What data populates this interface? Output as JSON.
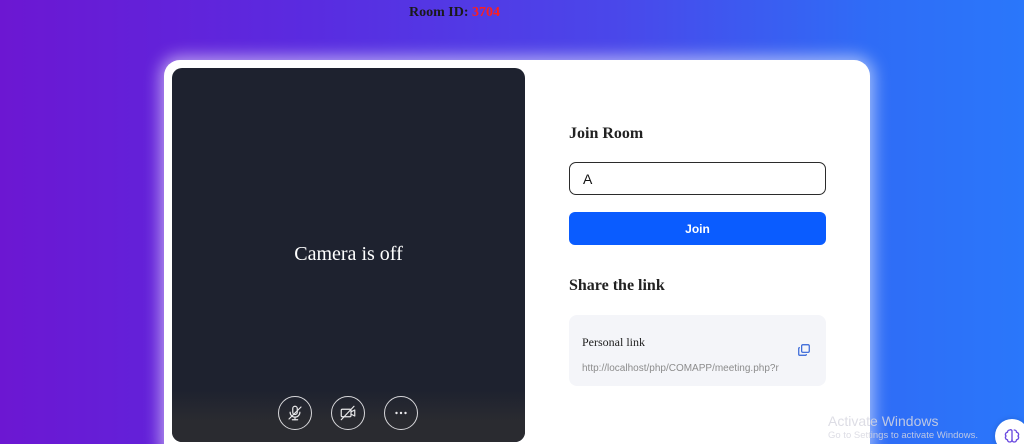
{
  "header": {
    "room_label": "Room ID:",
    "room_number": "3704"
  },
  "video": {
    "camera_status": "Camera is off",
    "controls": [
      {
        "name": "mic-off",
        "icon": "microphone-off-icon"
      },
      {
        "name": "camera-off",
        "icon": "video-off-icon"
      },
      {
        "name": "more",
        "icon": "more-dots-icon"
      }
    ]
  },
  "join": {
    "heading": "Join Room",
    "input_value": "A",
    "button_label": "Join"
  },
  "share": {
    "heading": "Share the link",
    "link_label": "Personal link",
    "link_url": "http://localhost/php/COMAPP/meeting.php?r",
    "copy_icon": "copy-icon"
  },
  "watermark": {
    "line1": "Activate Windows",
    "line2": "Go to Settings to activate Windows."
  },
  "colors": {
    "accent": "#0a5cff",
    "room_number": "#ff1e1e",
    "video_bg": "#1e222f"
  }
}
